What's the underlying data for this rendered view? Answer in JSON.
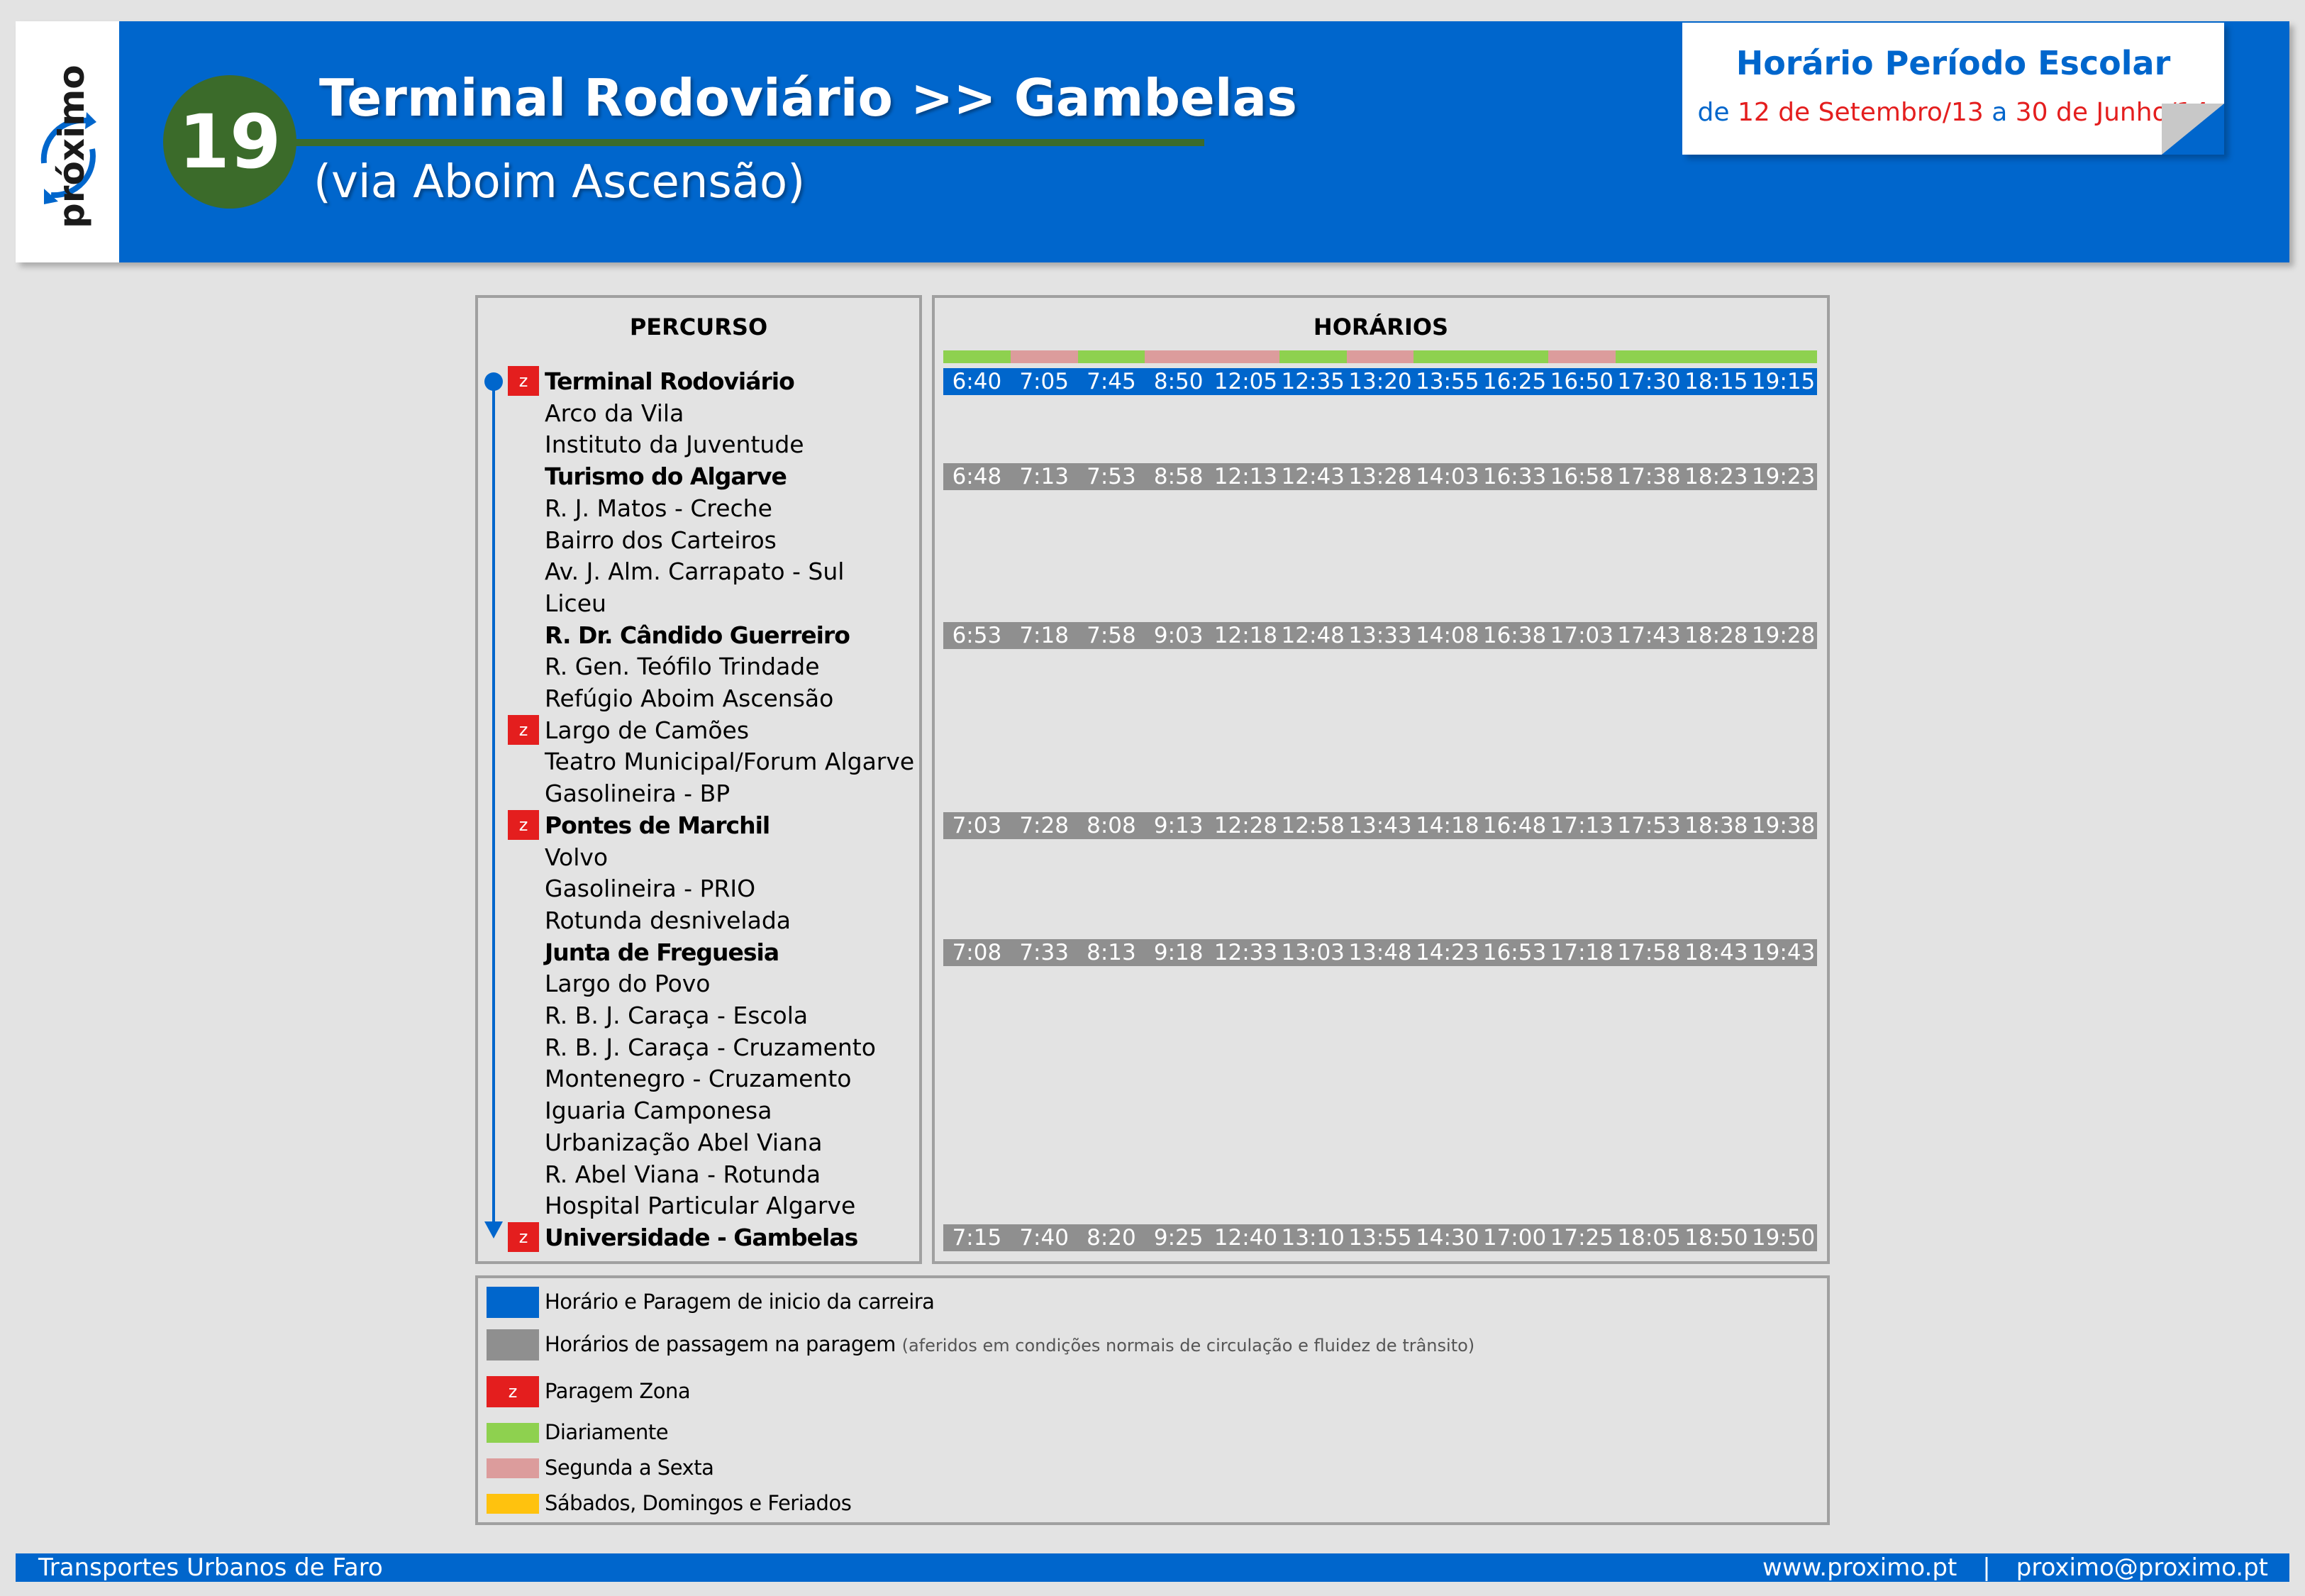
{
  "header": {
    "logo_text": "próximo",
    "route_number": "19",
    "title": "Terminal Rodoviário >> Gambelas",
    "via": "(via Aboim Ascensão)"
  },
  "schedule": {
    "title": "Horário Período Escolar",
    "prefix": "de",
    "start": "12 de Setembro/13",
    "connector": "a",
    "end": "30 de Junho/14"
  },
  "panels": {
    "percurso_title": "PERCURSO",
    "horarios_title": "HORÁRIOS"
  },
  "colors": {
    "brand_blue": "#0066cc",
    "route_green": "#3b6b2a",
    "zone_red": "#e41e1e",
    "pass_gray": "#8f8f8f",
    "daily_green": "#8ed14f",
    "weekday_pink": "#dc9c9c",
    "weekend_yellow": "#ffc20e"
  },
  "frequency": [
    "diariamente",
    "segunda_sexta",
    "diariamente",
    "segunda_sexta",
    "segunda_sexta",
    "diariamente",
    "segunda_sexta",
    "diariamente",
    "diariamente",
    "segunda_sexta",
    "diariamente",
    "diariamente",
    "diariamente"
  ],
  "stops": [
    {
      "name": "Terminal Rodoviário",
      "major": true,
      "zone": true,
      "times": [
        "6:40",
        "7:05",
        "7:45",
        "8:50",
        "12:05",
        "12:35",
        "13:20",
        "13:55",
        "16:25",
        "16:50",
        "17:30",
        "18:15",
        "19:15"
      ],
      "type": "start"
    },
    {
      "name": "Arco da Vila",
      "major": false,
      "zone": false
    },
    {
      "name": "Instituto da Juventude",
      "major": false,
      "zone": false
    },
    {
      "name": "Turismo do Algarve",
      "major": true,
      "zone": false,
      "times": [
        "6:48",
        "7:13",
        "7:53",
        "8:58",
        "12:13",
        "12:43",
        "13:28",
        "14:03",
        "16:33",
        "16:58",
        "17:38",
        "18:23",
        "19:23"
      ],
      "type": "pass"
    },
    {
      "name": "R. J. Matos - Creche",
      "major": false,
      "zone": false
    },
    {
      "name": "Bairro dos Carteiros",
      "major": false,
      "zone": false
    },
    {
      "name": "Av. J. Alm. Carrapato - Sul",
      "major": false,
      "zone": false
    },
    {
      "name": "Liceu",
      "major": false,
      "zone": false
    },
    {
      "name": "R. Dr. Cândido Guerreiro",
      "major": true,
      "zone": false,
      "times": [
        "6:53",
        "7:18",
        "7:58",
        "9:03",
        "12:18",
        "12:48",
        "13:33",
        "14:08",
        "16:38",
        "17:03",
        "17:43",
        "18:28",
        "19:28"
      ],
      "type": "pass"
    },
    {
      "name": "R. Gen. Teófilo Trindade",
      "major": false,
      "zone": false
    },
    {
      "name": "Refúgio Aboim Ascensão",
      "major": false,
      "zone": false
    },
    {
      "name": "Largo de Camões",
      "major": false,
      "zone": true
    },
    {
      "name": "Teatro Municipal/Forum Algarve",
      "major": false,
      "zone": false
    },
    {
      "name": "Gasolineira - BP",
      "major": false,
      "zone": false
    },
    {
      "name": "Pontes de Marchil",
      "major": true,
      "zone": true,
      "times": [
        "7:03",
        "7:28",
        "8:08",
        "9:13",
        "12:28",
        "12:58",
        "13:43",
        "14:18",
        "16:48",
        "17:13",
        "17:53",
        "18:38",
        "19:38"
      ],
      "type": "pass"
    },
    {
      "name": "Volvo",
      "major": false,
      "zone": false
    },
    {
      "name": "Gasolineira - PRIO",
      "major": false,
      "zone": false
    },
    {
      "name": "Rotunda desnivelada",
      "major": false,
      "zone": false
    },
    {
      "name": "Junta de Freguesia",
      "major": true,
      "zone": false,
      "times": [
        "7:08",
        "7:33",
        "8:13",
        "9:18",
        "12:33",
        "13:03",
        "13:48",
        "14:23",
        "16:53",
        "17:18",
        "17:58",
        "18:43",
        "19:43"
      ],
      "type": "pass"
    },
    {
      "name": "Largo do Povo",
      "major": false,
      "zone": false
    },
    {
      "name": "R. B. J. Caraça - Escola",
      "major": false,
      "zone": false
    },
    {
      "name": "R. B. J. Caraça - Cruzamento",
      "major": false,
      "zone": false
    },
    {
      "name": "Montenegro - Cruzamento",
      "major": false,
      "zone": false
    },
    {
      "name": "Iguaria Camponesa",
      "major": false,
      "zone": false
    },
    {
      "name": "Urbanização Abel Viana",
      "major": false,
      "zone": false
    },
    {
      "name": "R. Abel Viana - Rotunda",
      "major": false,
      "zone": false
    },
    {
      "name": "Hospital Particular Algarve",
      "major": false,
      "zone": false
    },
    {
      "name": "Universidade - Gambelas",
      "major": true,
      "zone": true,
      "times": [
        "7:15",
        "7:40",
        "8:20",
        "9:25",
        "12:40",
        "13:10",
        "13:55",
        "14:30",
        "17:00",
        "17:25",
        "18:05",
        "18:50",
        "19:50"
      ],
      "type": "pass"
    }
  ],
  "zone_badge": "z",
  "legend": [
    {
      "kind": "start",
      "label": "Horário e Paragem de inicio da carreira"
    },
    {
      "kind": "pass",
      "label": "Horários de passagem na paragem",
      "note": "(aferidos em condições normais de circulação e fluidez de trânsito)"
    },
    {
      "kind": "zone",
      "label": "Paragem Zona"
    },
    {
      "kind": "daily",
      "label": "Diariamente"
    },
    {
      "kind": "weekday",
      "label": "Segunda a Sexta"
    },
    {
      "kind": "weekend",
      "label": "Sábados, Domingos e Feriados"
    }
  ],
  "footer": {
    "operator": "Transportes Urbanos de Faro",
    "website": "www.proximo.pt",
    "separator": "|",
    "email": "proximo@proximo.pt"
  }
}
